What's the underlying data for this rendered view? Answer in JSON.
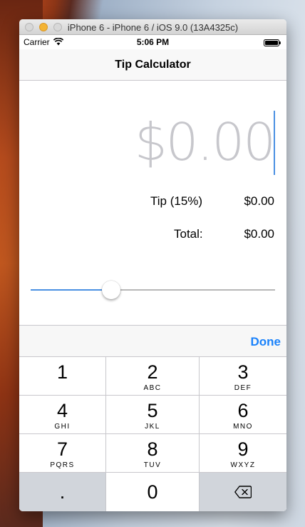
{
  "simulator": {
    "window_title": "iPhone 6 - iPhone 6 / iOS 9.0 (13A4325c)"
  },
  "status_bar": {
    "carrier": "Carrier",
    "time": "5:06 PM",
    "wifi_icon": "wifi-icon",
    "battery_icon": "battery-icon"
  },
  "nav": {
    "title": "Tip Calculator"
  },
  "calculator": {
    "bill_placeholder": "$0.00",
    "tip_label": "Tip (15%)",
    "tip_value": "$0.00",
    "total_label": "Total:",
    "total_value": "$0.00",
    "tip_slider_fraction": 0.33
  },
  "accessory": {
    "done_label": "Done"
  },
  "keypad": {
    "keys": [
      {
        "digit": "1",
        "letters": ""
      },
      {
        "digit": "2",
        "letters": "ABC"
      },
      {
        "digit": "3",
        "letters": "DEF"
      },
      {
        "digit": "4",
        "letters": "GHI"
      },
      {
        "digit": "5",
        "letters": "JKL"
      },
      {
        "digit": "6",
        "letters": "MNO"
      },
      {
        "digit": "7",
        "letters": "PQRS"
      },
      {
        "digit": "8",
        "letters": "TUV"
      },
      {
        "digit": "9",
        "letters": "WXYZ"
      }
    ],
    "decimal": ".",
    "zero": "0",
    "delete_icon": "backspace-icon"
  },
  "colors": {
    "accent": "#1a82fb",
    "slider_min": "#4a90e2",
    "placeholder": "#c7c7cc",
    "key_dark": "#d1d5db"
  }
}
